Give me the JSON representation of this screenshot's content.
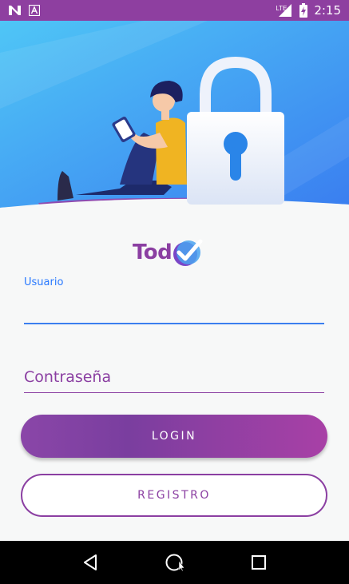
{
  "status_bar": {
    "time": "2:15",
    "network": "LTE",
    "icons": [
      "notification-n-icon",
      "notification-a-icon",
      "signal-icon",
      "battery-charging-icon"
    ]
  },
  "colors": {
    "primary": "#8b3fa2",
    "accent_blue": "#2979ff",
    "hero_blue_light": "#4fc3f7",
    "hero_blue_dark": "#3d7ff0",
    "background": "#f7f8f8"
  },
  "logo": {
    "text": "Tod",
    "mark": "check-badge-icon"
  },
  "form": {
    "username_label": "Usuario",
    "username_value": "",
    "password_placeholder": "Contraseña",
    "password_value": ""
  },
  "buttons": {
    "login_label": "LOGIN",
    "register_label": "REGISTRO"
  },
  "nav_bar": {
    "icons": [
      "back-icon",
      "home-icon",
      "recents-icon"
    ]
  }
}
